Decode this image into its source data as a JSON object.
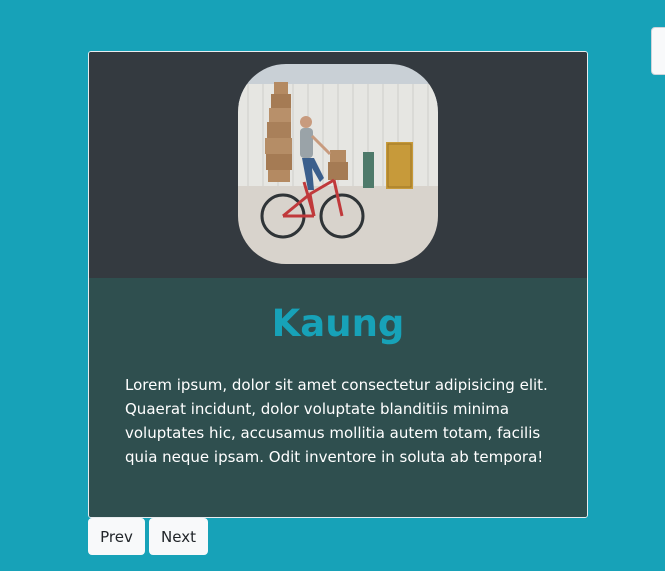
{
  "profile": {
    "name": "Kaung",
    "bio": "Lorem ipsum, dolor sit amet consectetur adipisicing elit. Quaerat incidunt, dolor voluptate blanditiis minima voluptates hic, accusamus mollitia autem totam, facilis quia neque ipsam. Odit inventore in soluta ab tempora!"
  },
  "nav": {
    "prev_label": "Prev",
    "next_label": "Next"
  },
  "colors": {
    "page_background": "#17a2b8",
    "card_top": "#343a40",
    "card_body": "#2f4f4f",
    "name_color": "#17a2b8"
  }
}
